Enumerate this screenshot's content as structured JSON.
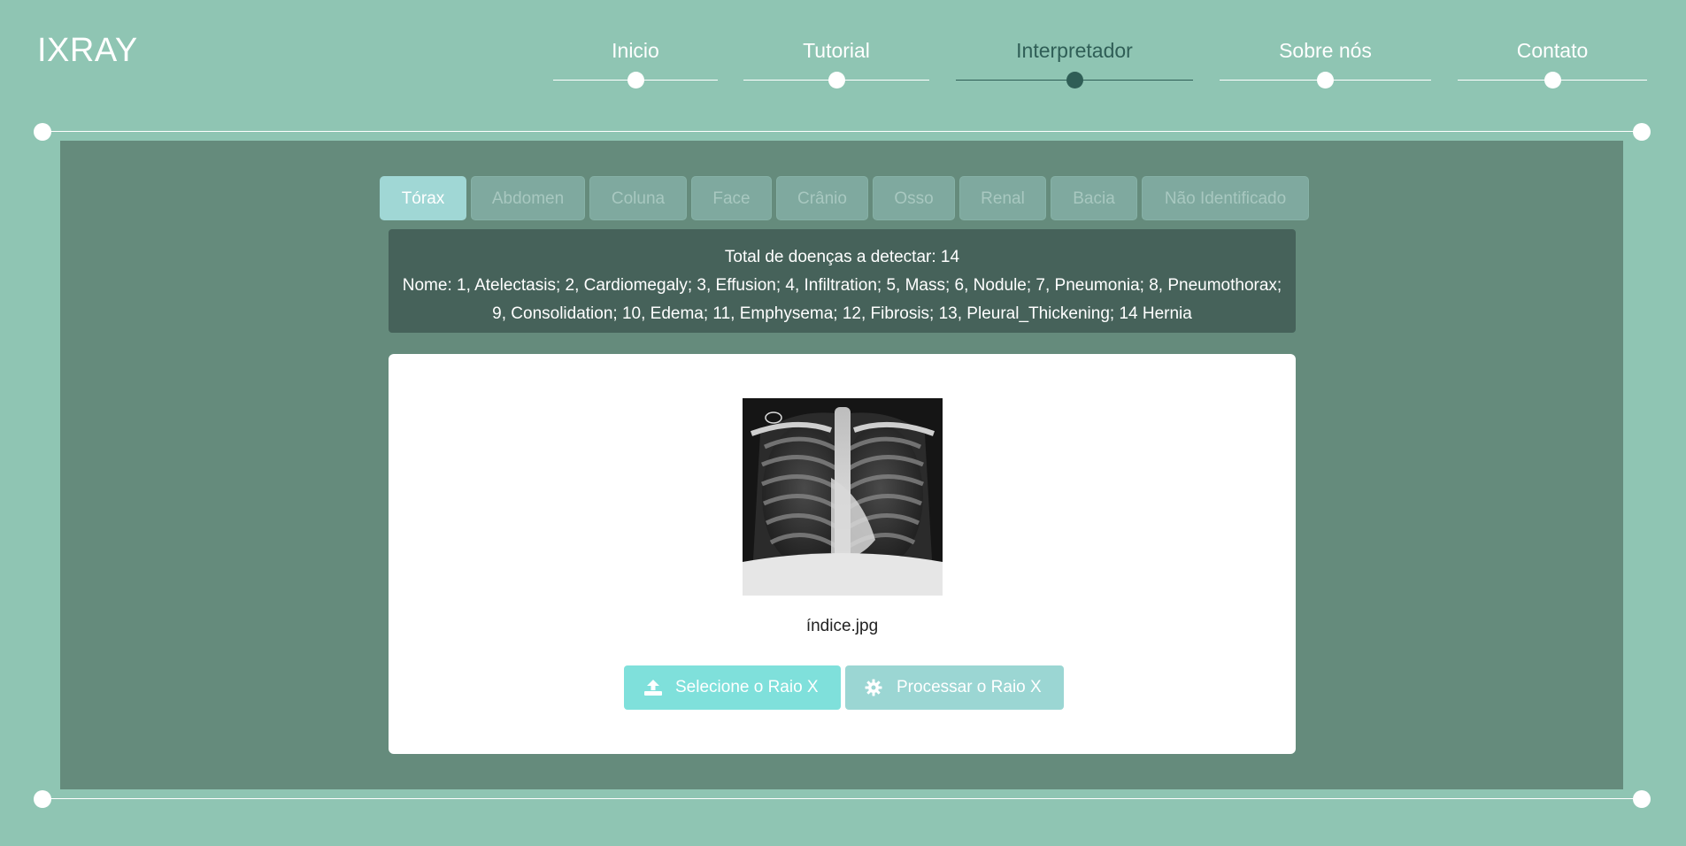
{
  "brand": "IXRAY",
  "nav": {
    "items": [
      {
        "label": "Inicio"
      },
      {
        "label": "Tutorial"
      },
      {
        "label": "Interpretador",
        "active": true
      },
      {
        "label": "Sobre nós"
      },
      {
        "label": "Contato"
      }
    ]
  },
  "tabs": [
    {
      "label": "Tórax",
      "active": true
    },
    {
      "label": "Abdomen"
    },
    {
      "label": "Coluna"
    },
    {
      "label": "Face"
    },
    {
      "label": "Crânio"
    },
    {
      "label": "Osso"
    },
    {
      "label": "Renal"
    },
    {
      "label": "Bacia"
    },
    {
      "label": "Não Identificado"
    }
  ],
  "info": {
    "total": "Total de doenças a detectar: 14",
    "names_line1": "Nome: 1, Atelectasis; 2, Cardiomegaly; 3, Effusion; 4, Infiltration; 5, Mass; 6, Nodule; 7, Pneumonia; 8, Pneumothorax;",
    "names_line2": "9, Consolidation; 10, Edema; 11, Emphysema; 12, Fibrosis; 13, Pleural_Thickening; 14 Hernia"
  },
  "upload": {
    "filename": "índice.jpg",
    "select_label": "Selecione o Raio X",
    "process_label": "Processar o Raio X",
    "select_icon": "upload-icon",
    "process_icon": "gear-icon"
  },
  "colors": {
    "background": "#8fc5b3",
    "panel": "#658b7c",
    "info_box": "#46625a",
    "active_tab": "#a0d7d5",
    "select_button": "#7fe0db",
    "process_button": "#9bd6d3",
    "active_nav": "#2f5e56"
  }
}
